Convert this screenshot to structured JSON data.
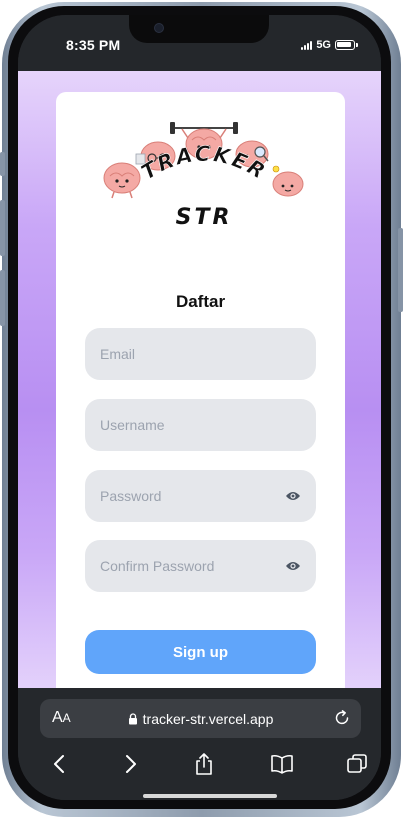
{
  "status_bar": {
    "time": "8:35 PM",
    "network": "5G"
  },
  "logo": {
    "line1": "TRACKER",
    "line2": "STR"
  },
  "form": {
    "title": "Daftar",
    "email_placeholder": "Email",
    "username_placeholder": "Username",
    "password_placeholder": "Password",
    "confirm_password_placeholder": "Confirm Password",
    "submit_label": "Sign up"
  },
  "browser": {
    "aa_large": "A",
    "aa_small": "A",
    "url": "tracker-str.vercel.app"
  },
  "colors": {
    "background_gradient": [
      "#e6d4fb",
      "#b88ff2"
    ],
    "input_bg": "#e5e7eb",
    "button": "#60a5fa",
    "browser_chrome": "#25282c"
  }
}
